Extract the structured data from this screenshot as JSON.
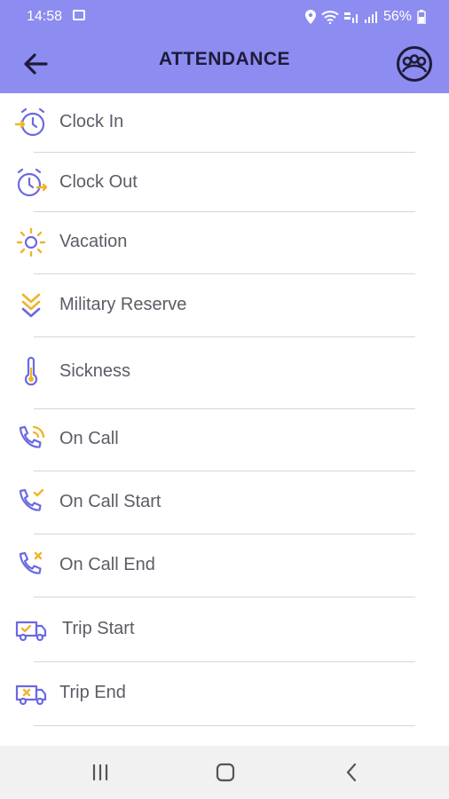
{
  "status_bar": {
    "time": "14:58",
    "battery": "56%"
  },
  "header": {
    "title": "ATTENDANCE",
    "bg_color": "#8d8cf0"
  },
  "accent_colors": {
    "primary": "#6b69e0",
    "secondary": "#f0b429"
  },
  "menu": {
    "items": [
      {
        "label": "Clock In",
        "icon": "clock-in-icon"
      },
      {
        "label": "Clock Out",
        "icon": "clock-out-icon"
      },
      {
        "label": "Vacation",
        "icon": "sun-icon"
      },
      {
        "label": "Military Reserve",
        "icon": "chevrons-down-icon"
      },
      {
        "label": "Sickness",
        "icon": "thermometer-icon"
      },
      {
        "label": "On Call",
        "icon": "phone-ringing-icon"
      },
      {
        "label": "On Call Start",
        "icon": "phone-check-icon"
      },
      {
        "label": "On Call End",
        "icon": "phone-x-icon"
      },
      {
        "label": "Trip Start",
        "icon": "truck-check-icon"
      },
      {
        "label": "Trip End",
        "icon": "truck-x-icon"
      }
    ]
  }
}
